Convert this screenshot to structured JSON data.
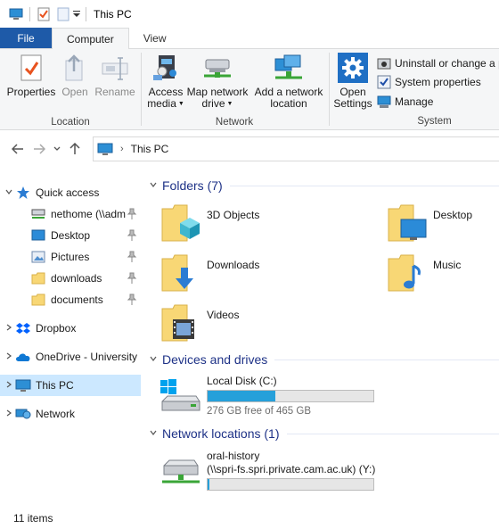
{
  "window": {
    "title": "This PC"
  },
  "tabs": [
    {
      "label": "File"
    },
    {
      "label": "Computer"
    },
    {
      "label": "View"
    }
  ],
  "ribbon": {
    "location": {
      "label": "Location",
      "properties": "Properties",
      "open": "Open",
      "rename": "Rename"
    },
    "network": {
      "label": "Network",
      "access_media_1": "Access",
      "access_media_2": "media",
      "map_drive_1": "Map network",
      "map_drive_2": "drive",
      "add_location_1": "Add a network",
      "add_location_2": "location"
    },
    "system": {
      "label": "System",
      "open_settings_1": "Open",
      "open_settings_2": "Settings",
      "uninstall": "Uninstall or change a p",
      "system_properties": "System properties",
      "manage": "Manage"
    }
  },
  "address": {
    "crumb": "This PC"
  },
  "nav": {
    "quick_access": "Quick access",
    "nethome": "nethome (\\\\adm",
    "desktop": "Desktop",
    "pictures": "Pictures",
    "downloads": "downloads",
    "documents": "documents",
    "dropbox": "Dropbox",
    "onedrive": "OneDrive - University",
    "this_pc": "This PC",
    "network": "Network"
  },
  "folders_section": {
    "title": "Folders (7)",
    "items": [
      {
        "name": "3D Objects"
      },
      {
        "name": "Desktop"
      },
      {
        "name": "Downloads"
      },
      {
        "name": "Music"
      },
      {
        "name": "Videos"
      }
    ]
  },
  "devices_section": {
    "title": "Devices and drives",
    "drive": {
      "name": "Local Disk (C:)",
      "free": "276 GB free of 465 GB",
      "used_fraction": 0.406
    }
  },
  "netloc_section": {
    "title": "Network locations (1)",
    "location": {
      "name_1": "oral-history",
      "name_2": "(\\\\spri-fs.spri.private.cam.ac.uk) (Y:)",
      "used_fraction": 0.01
    }
  },
  "status": {
    "items": "11 items"
  },
  "colors": {
    "file_tab": "#1e5aa8",
    "section_title": "#1e3287",
    "bar_fill": "#26a0da",
    "selected": "#cce8ff"
  }
}
